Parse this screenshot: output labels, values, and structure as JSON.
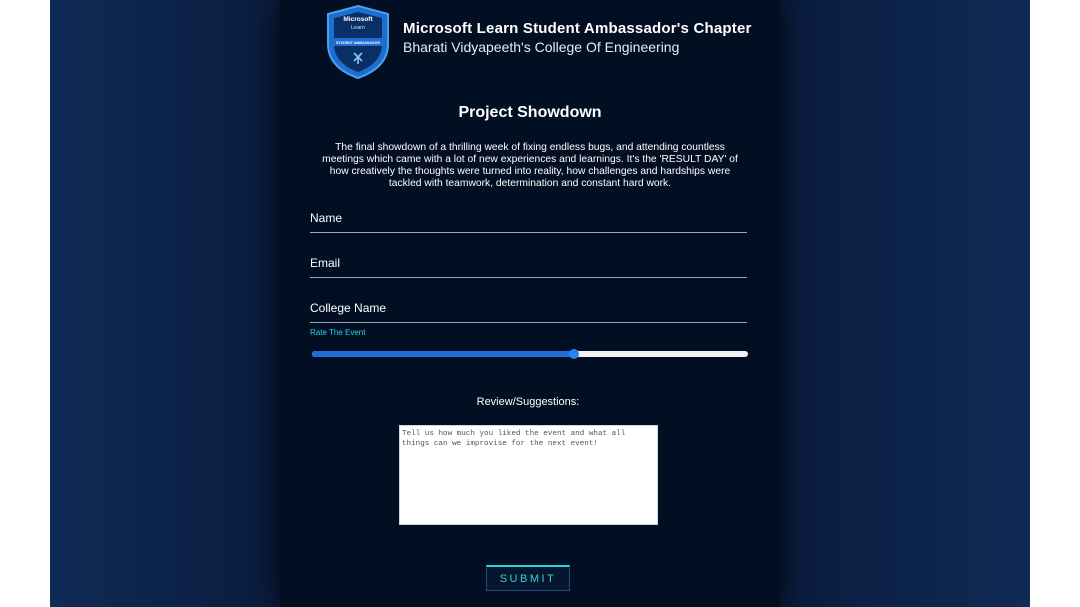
{
  "header": {
    "badge": {
      "line1": "Microsoft",
      "line2": "Learn",
      "ribbon": "STUDENT AMBASSADOR"
    },
    "title": "Microsoft Learn Student Ambassador's Chapter",
    "subtitle": "Bharati Vidyapeeth's College Of Engineering"
  },
  "form": {
    "title": "Project Showdown",
    "description": "The final showdown of a thrilling week of fixing endless bugs, and attending countless meetings which came with a lot of new experiences and learnings. It's the 'RESULT DAY' of how creatively the thoughts were turned into reality, how challenges and hardships were tackled with teamwork, determination and constant hard work.",
    "name_placeholder": "Name",
    "email_placeholder": "Email",
    "college_placeholder": "College Name",
    "rating_label": "Rate The Event",
    "rating_value": 60,
    "review_label": "Review/Suggestions:",
    "review_placeholder": "Tell us how much you liked the event and what all things can we improvise for the next event!",
    "submit_label": "SUBMIT"
  },
  "colors": {
    "page_bg": "#0d2447",
    "panel_bg": "#020f22",
    "accent_cyan": "#27d3e6",
    "slider_blue": "#1f6fd6",
    "badge_blue": "#1c6fd1"
  }
}
